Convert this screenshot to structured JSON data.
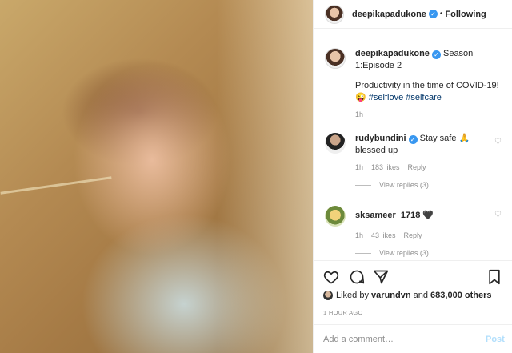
{
  "post": {
    "image_alt": "photo",
    "header": {
      "username": "deepikapadukone",
      "separator": "•",
      "follow_state": "Following"
    },
    "caption": {
      "username": "deepikapadukone",
      "title": "Season 1:Episode 2",
      "text": "Productivity in the time of COVID-19!",
      "emoji": "😜",
      "hashtags": [
        "#selflove",
        "#selfcare"
      ],
      "time": "1h"
    },
    "comments": [
      {
        "username": "rudybundini",
        "text": "Stay safe 🙏 blessed up",
        "time": "1h",
        "likes": "183 likes",
        "reply": "Reply",
        "view_replies": "View replies (3)"
      },
      {
        "username": "sksameer_1718",
        "text": "🖤",
        "time": "1h",
        "likes": "43 likes",
        "reply": "Reply",
        "view_replies": "View replies (3)"
      }
    ],
    "likes": {
      "prefix": "Liked by",
      "user": "varundvn",
      "conjunction": "and",
      "others": "683,000 others"
    },
    "timestamp": "1 HOUR AGO",
    "add_comment": {
      "placeholder": "Add a comment…",
      "post_label": "Post"
    }
  },
  "colors": {
    "verified": "#3897f0",
    "hashtag": "#003569",
    "muted": "#8e8e8e",
    "post_disabled": "#b2dffc"
  }
}
